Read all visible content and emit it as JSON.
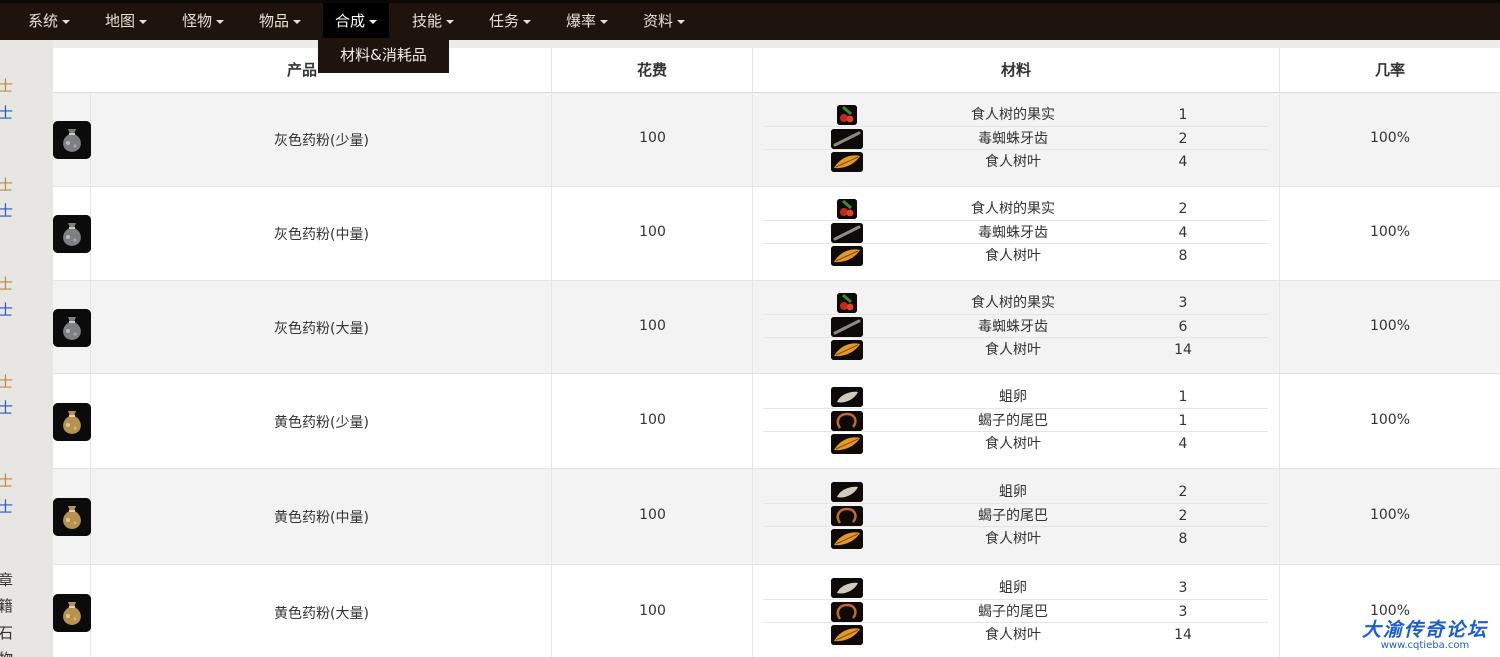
{
  "nav": {
    "items": [
      {
        "label": "系统"
      },
      {
        "label": "地图"
      },
      {
        "label": "怪物"
      },
      {
        "label": "物品"
      },
      {
        "label": "合成"
      },
      {
        "label": "技能"
      },
      {
        "label": "任务"
      },
      {
        "label": "爆率"
      },
      {
        "label": "资料"
      }
    ],
    "active_index": 4,
    "dropdown": {
      "item": "材料&消耗品"
    }
  },
  "left_strip": [
    "士",
    "士",
    "士",
    "士",
    "士",
    "士",
    "士",
    "士",
    "士",
    "士",
    "章",
    "籍",
    "石",
    "物"
  ],
  "table": {
    "headers": {
      "product": "产品",
      "cost": "花费",
      "materials": "材料",
      "rate": "几率"
    },
    "rows": [
      {
        "product": "灰色药粉(少量)",
        "cost": "100",
        "rate": "100%",
        "materials": [
          {
            "name": "食人树的果实",
            "qty": "1",
            "icon": "fruit-icon"
          },
          {
            "name": "毒蜘蛛牙齿",
            "qty": "2",
            "icon": "spider-fang-icon"
          },
          {
            "name": "食人树叶",
            "qty": "4",
            "icon": "leaf-icon"
          }
        ]
      },
      {
        "product": "灰色药粉(中量)",
        "cost": "100",
        "rate": "100%",
        "materials": [
          {
            "name": "食人树的果实",
            "qty": "2",
            "icon": "fruit-icon"
          },
          {
            "name": "毒蜘蛛牙齿",
            "qty": "4",
            "icon": "spider-fang-icon"
          },
          {
            "name": "食人树叶",
            "qty": "8",
            "icon": "leaf-icon"
          }
        ]
      },
      {
        "product": "灰色药粉(大量)",
        "cost": "100",
        "rate": "100%",
        "materials": [
          {
            "name": "食人树的果实",
            "qty": "3",
            "icon": "fruit-icon"
          },
          {
            "name": "毒蜘蛛牙齿",
            "qty": "6",
            "icon": "spider-fang-icon"
          },
          {
            "name": "食人树叶",
            "qty": "14",
            "icon": "leaf-icon"
          }
        ]
      },
      {
        "product": "黄色药粉(少量)",
        "cost": "100",
        "rate": "100%",
        "materials": [
          {
            "name": "蛆卵",
            "qty": "1",
            "icon": "maggot-egg-icon"
          },
          {
            "name": "蝎子的尾巴",
            "qty": "1",
            "icon": "scorpion-tail-icon"
          },
          {
            "name": "食人树叶",
            "qty": "4",
            "icon": "leaf-icon"
          }
        ]
      },
      {
        "product": "黄色药粉(中量)",
        "cost": "100",
        "rate": "100%",
        "materials": [
          {
            "name": "蛆卵",
            "qty": "2",
            "icon": "maggot-egg-icon"
          },
          {
            "name": "蝎子的尾巴",
            "qty": "2",
            "icon": "scorpion-tail-icon"
          },
          {
            "name": "食人树叶",
            "qty": "8",
            "icon": "leaf-icon"
          }
        ]
      },
      {
        "product": "黄色药粉(大量)",
        "cost": "100",
        "rate": "100%",
        "materials": [
          {
            "name": "蛆卵",
            "qty": "3",
            "icon": "maggot-egg-icon"
          },
          {
            "name": "蝎子的尾巴",
            "qty": "3",
            "icon": "scorpion-tail-icon"
          },
          {
            "name": "食人树叶",
            "qty": "14",
            "icon": "leaf-icon"
          }
        ]
      }
    ]
  },
  "watermark": {
    "title": "大渝传奇论坛",
    "url": "www.cqtieba.com"
  },
  "colors": {
    "nav_bg": "#1f140d",
    "row_alt": "#f3f3f3",
    "watermark": "#1a5fd0"
  }
}
